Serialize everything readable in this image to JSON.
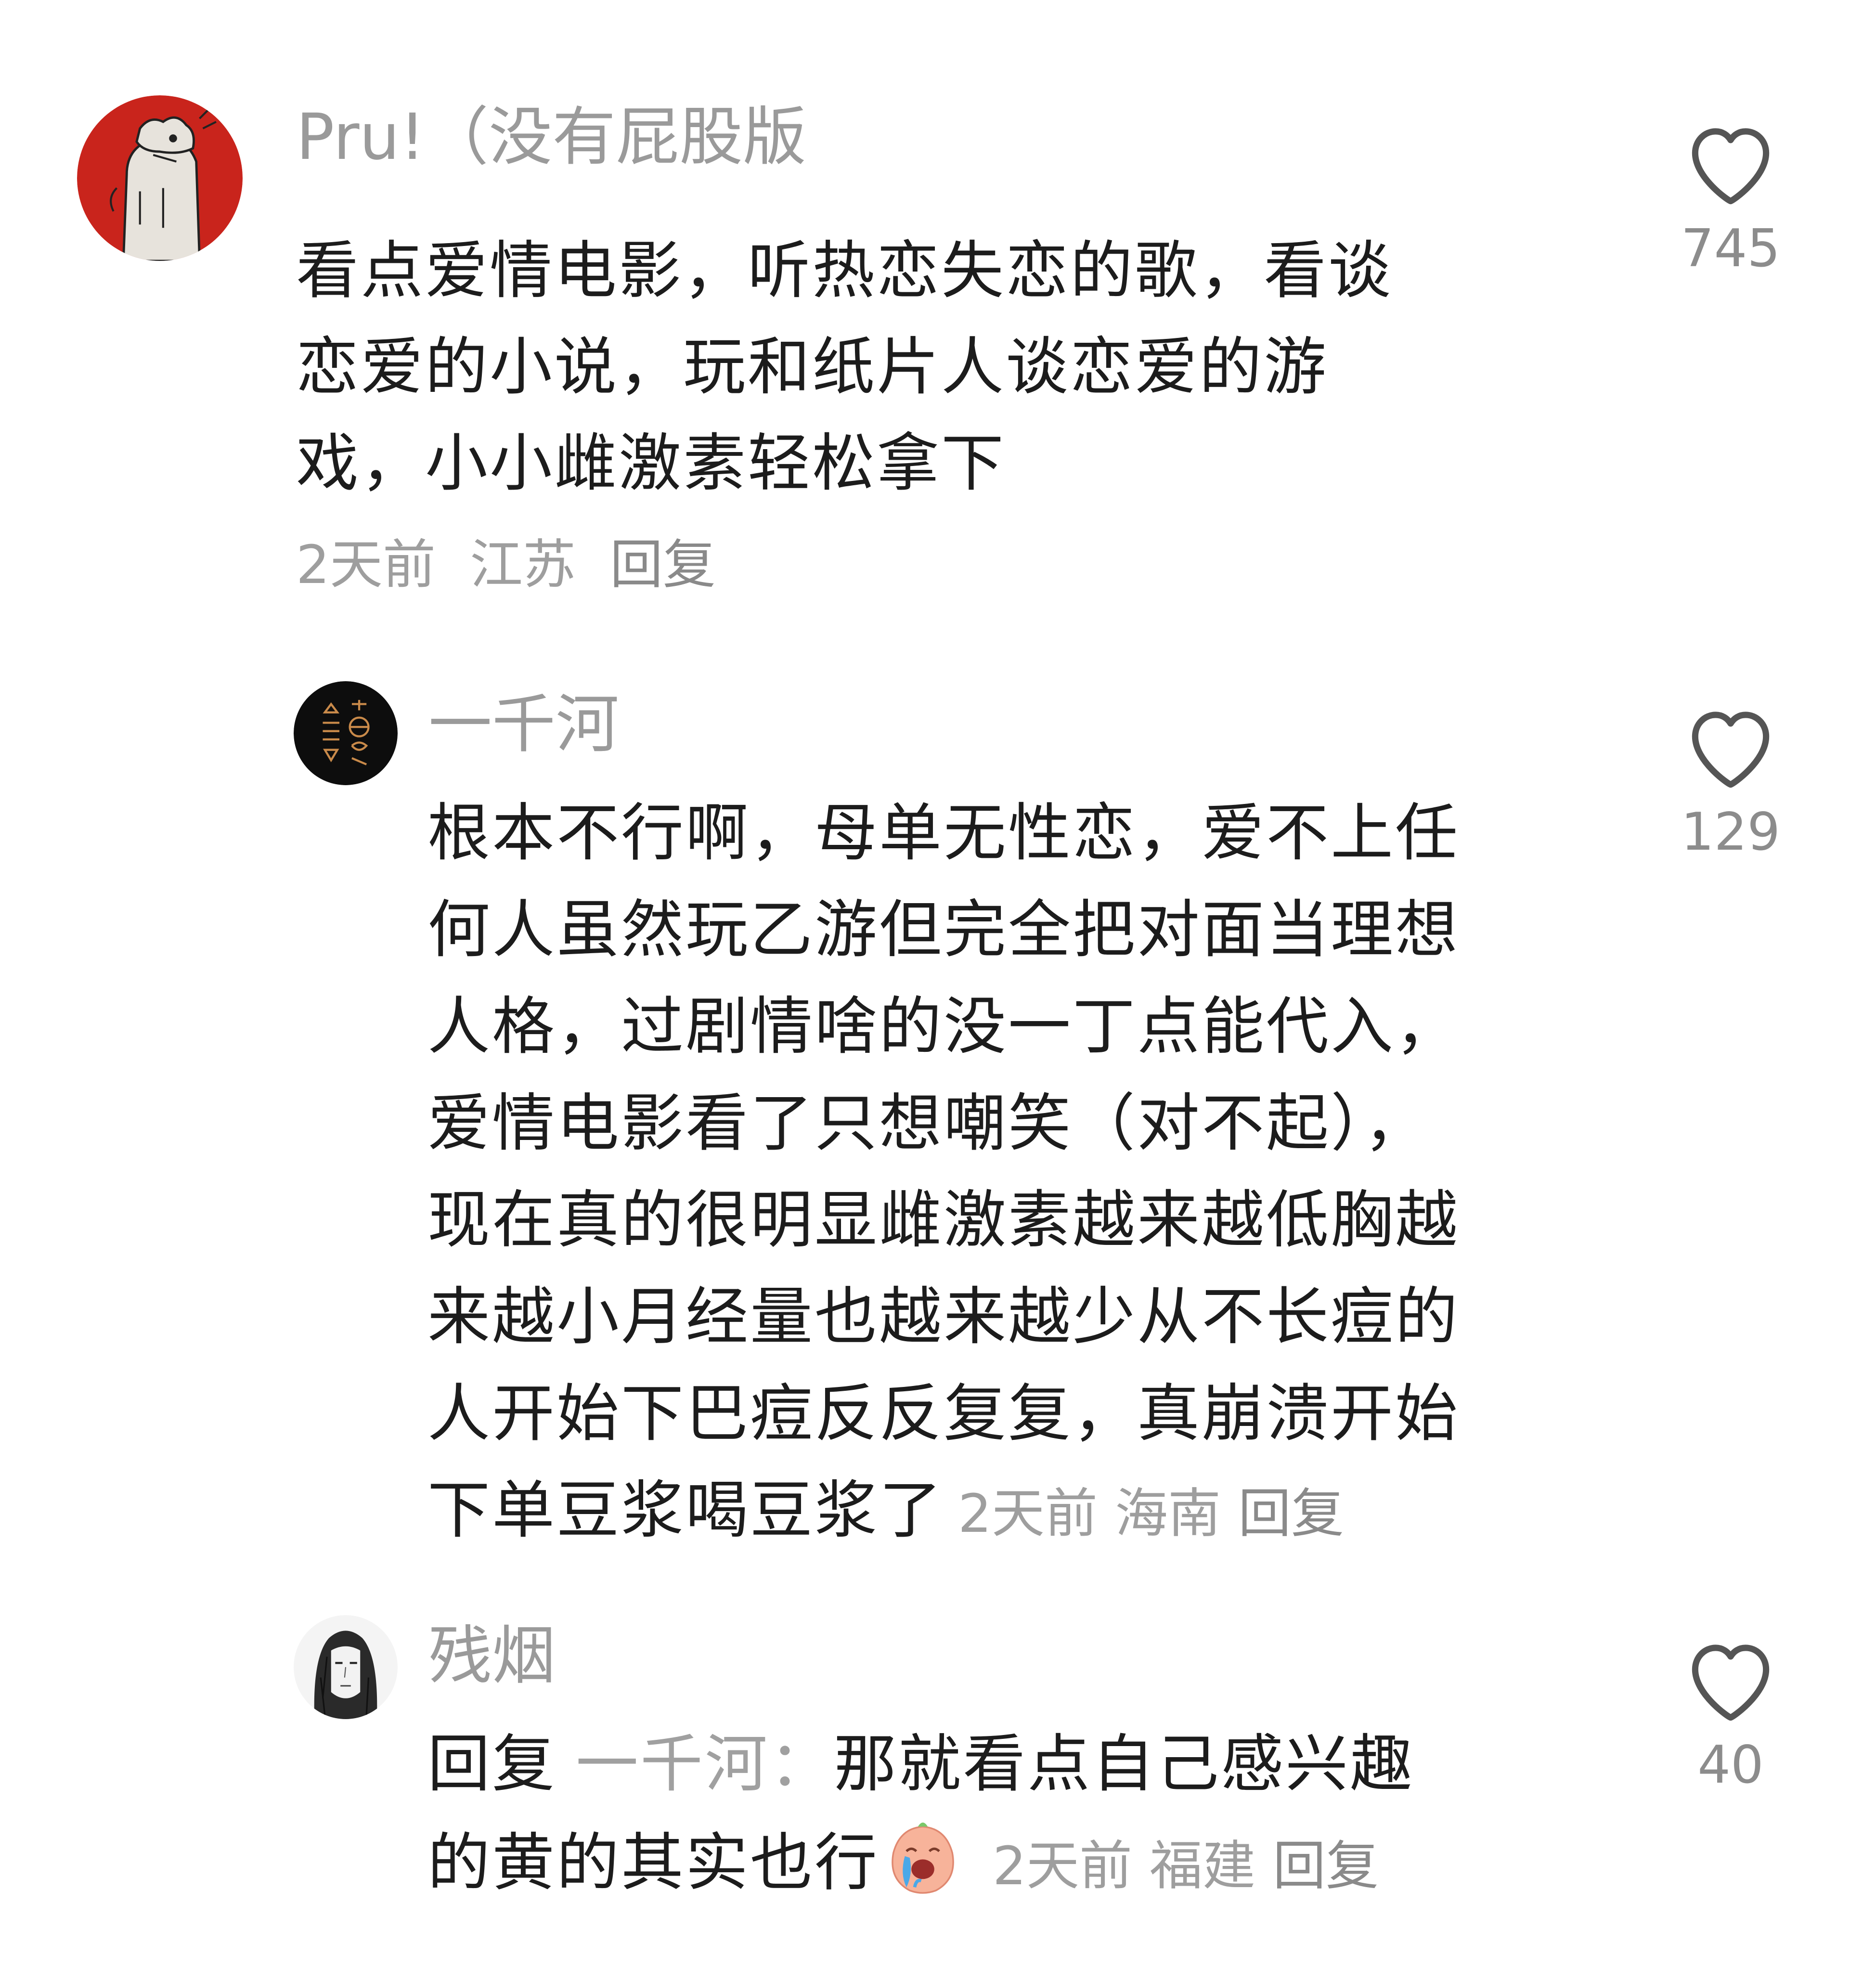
{
  "comments": [
    {
      "username": "Pru!（没有屁股版",
      "lines": [
        "看点爱情电影，听热恋失恋的歌，看谈",
        "恋爱的小说，玩和纸片人谈恋爱的游",
        "戏，小小雌激素轻松拿下"
      ],
      "time": "2天前",
      "location": "江苏",
      "reply_label": "回复",
      "likes": "745",
      "like_icon": "heart-outline-icon",
      "avatar": "cartoon-figure-red-avatar"
    },
    {
      "username": "一千河",
      "lines": [
        "根本不行啊，母单无性恋，爱不上任",
        "何人虽然玩乙游但完全把对面当理想",
        "人格，过剧情啥的没一丁点能代入，",
        "爱情电影看了只想嘲笑（对不起），",
        "现在真的很明显雌激素越来越低胸越",
        "来越小月经量也越来越少从不长痘的",
        "人开始下巴痘反反复复，真崩溃开始"
      ],
      "last_line": "下单豆浆喝豆浆了",
      "time": "2天前",
      "location": "海南",
      "reply_label": "回复",
      "likes": "129",
      "like_icon": "heart-outline-icon",
      "avatar": "dark-emblem-avatar"
    },
    {
      "username": "残烟",
      "reply_prefix": "回复",
      "reply_target": "一千河：",
      "line1_rest": "那就看点自己感兴趣",
      "line2": "的黄的其实也行",
      "emoji": "crying-face-emoji",
      "time": "2天前",
      "location": "福建",
      "reply_label": "回复",
      "likes": "40",
      "like_icon": "heart-outline-icon",
      "avatar": "sketch-portrait-avatar"
    }
  ]
}
